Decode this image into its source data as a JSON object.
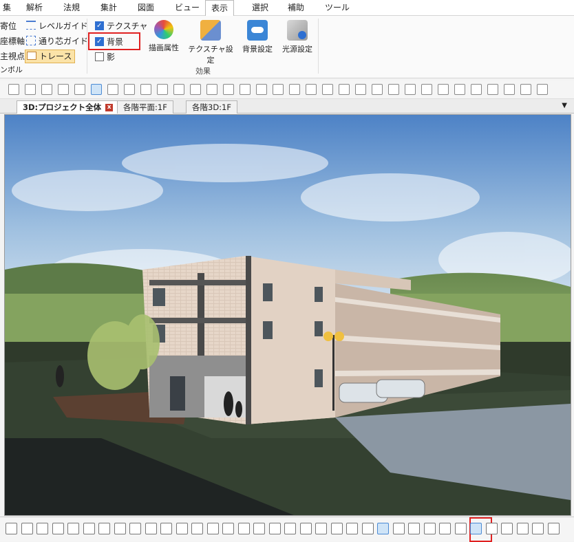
{
  "menu": {
    "items": [
      "集",
      "解析",
      "法規",
      "集計",
      "図面",
      "ビュー",
      "表示",
      "選択",
      "補助",
      "ツール"
    ],
    "active": "表示"
  },
  "ribbon": {
    "left_partial": [
      "寄位",
      "座標軸",
      "主視点",
      "ンボル"
    ],
    "guides": {
      "level_guide": "レベルガイド",
      "grid_guide": "通り芯ガイド",
      "trace": "トレース"
    },
    "effects": {
      "texture": {
        "label": "テクスチャ",
        "checked": true
      },
      "background": {
        "label": "背景",
        "checked": true
      },
      "shadow": {
        "label": "影",
        "checked": false
      },
      "buttons": [
        "描画属性",
        "テクスチャ設定",
        "背景設定",
        "光源設定"
      ],
      "group_label": "効果"
    }
  },
  "tabs": [
    {
      "label": "3D:プロジェクト全体",
      "active": true
    },
    {
      "label": "各階平面:1F",
      "active": false
    },
    {
      "label": "各階3D:1F",
      "active": false
    }
  ],
  "icons": {
    "toolbar": [
      "select-icon",
      "wall-icon",
      "column-icon",
      "beam-icon",
      "slab-icon",
      "roof-icon",
      "door-icon",
      "window-icon",
      "stair-icon",
      "room-icon",
      "text-icon",
      "dimension-icon"
    ],
    "bottom": [
      "orbit-icon",
      "walk-icon",
      "eye-icon",
      "zoom-icon",
      "pan-icon",
      "render-icon",
      "camera-icon"
    ]
  },
  "colors": {
    "accent": "#2e6fd1",
    "highlight_red": "#e02020",
    "trace_active": "#fbe3a8"
  }
}
